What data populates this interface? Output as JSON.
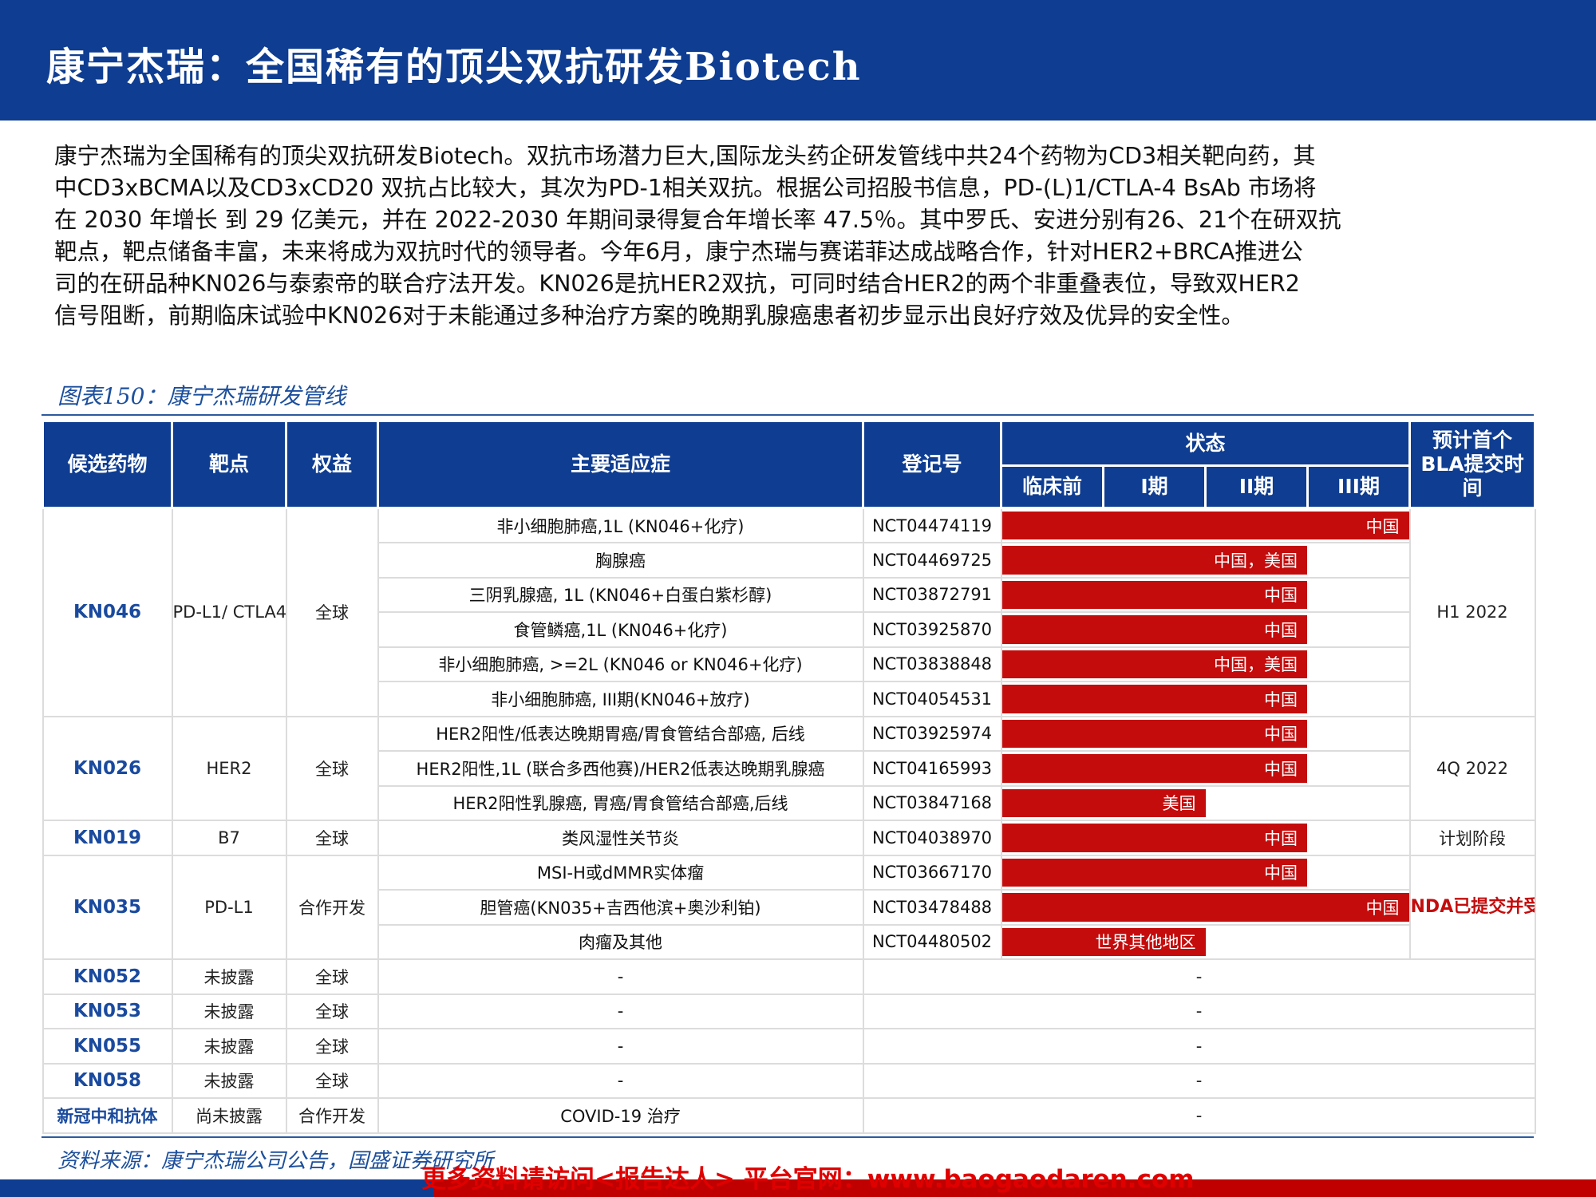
{
  "header": {
    "title": "康宁杰瑞：全国稀有的顶尖双抗研发Biotech"
  },
  "intro": {
    "lines": [
      "康宁杰瑞为全国稀有的顶尖双抗研发Biotech。双抗市场潜力巨大,国际龙头药企研发管线中共24个药物为CD3相关靶向药，其",
      "中CD3xBCMA以及CD3xCD20 双抗占比较大，其次为PD-1相关双抗。根据公司招股书信息，PD-(L)1/CTLA-4 BsAb 市场将",
      "在 2030 年增长 到 29 亿美元，并在 2022-2030 年期间录得复合年增长率 47.5％。其中罗氏、安进分别有26、21个在研双抗",
      "靶点，靶点储备丰富，未来将成为双抗时代的领导者。今年6月，康宁杰瑞与赛诺菲达成战略合作，针对HER2+BRCA推进公",
      "司的在研品种KN026与泰索帝的联合疗法开发。KN026是抗HER2双抗，可同时结合HER2的两个非重叠表位，导致双HER2",
      "信号阻断，前期临床试验中KN026对于未能通过多种治疗方案的晚期乳腺癌患者初步显示出良好疗效及优异的安全性。"
    ]
  },
  "figure": {
    "caption": "图表150：康宁杰瑞研发管线"
  },
  "table": {
    "headers": {
      "candidate": "候选药物",
      "target": "靶点",
      "rights": "权益",
      "indication": "主要适应症",
      "registration": "登记号",
      "status": "状态",
      "preclinical": "临床前",
      "phase1": "I期",
      "phase2": "II期",
      "phase3": "III期",
      "bla": "预计首个BLA提交时间"
    },
    "rows": [
      {
        "candidate": "KN046",
        "target": "PD-L1/ CTLA4",
        "rights": "全球",
        "bla": "H1 2022",
        "indications": [
          {
            "indication": "非小细胞肺癌,1L (KN046+化疗)",
            "registration": "NCT04474119",
            "region": "中国",
            "phase": 4
          },
          {
            "indication": "胸腺癌",
            "registration": "NCT04469725",
            "region": "中国，美国",
            "phase": 3
          },
          {
            "indication": "三阴乳腺癌, 1L (KN046+白蛋白紫杉醇)",
            "registration": "NCT03872791",
            "region": "中国",
            "phase": 3
          },
          {
            "indication": "食管鳞癌,1L (KN046+化疗)",
            "registration": "NCT03925870",
            "region": "中国",
            "phase": 3
          },
          {
            "indication": "非小细胞肺癌, >=2L (KN046 or KN046+化疗)",
            "registration": "NCT03838848",
            "region": "中国，美国",
            "phase": 3
          },
          {
            "indication": "非小细胞肺癌, III期(KN046+放疗)",
            "registration": "NCT04054531",
            "region": "中国",
            "phase": 3
          }
        ]
      },
      {
        "candidate": "KN026",
        "target": "HER2",
        "rights": "全球",
        "bla": "4Q 2022",
        "indications": [
          {
            "indication": "HER2阳性/低表达晚期胃癌/胃食管结合部癌, 后线",
            "registration": "NCT03925974",
            "region": "中国",
            "phase": 3
          },
          {
            "indication": "HER2阳性,1L (联合多西他赛)/HER2低表达晚期乳腺癌",
            "registration": "NCT04165993",
            "region": "中国",
            "phase": 3
          },
          {
            "indication": "HER2阳性乳腺癌, 胃癌/胃食管结合部癌,后线",
            "registration": "NCT03847168",
            "region": "美国",
            "phase": 2
          }
        ]
      },
      {
        "candidate": "KN019",
        "target": "B7",
        "rights": "全球",
        "bla": "计划阶段",
        "indications": [
          {
            "indication": "类风湿性关节炎",
            "registration": "NCT04038970",
            "region": "中国",
            "phase": 3
          }
        ]
      },
      {
        "candidate": "KN035",
        "target": "PD-L1",
        "rights": "合作开发",
        "bla": "NDA已提交并受理",
        "indications": [
          {
            "indication": "MSI-H或dMMR实体瘤",
            "registration": "NCT03667170",
            "region": "中国",
            "phase": 3
          },
          {
            "indication": "胆管癌(KN035+吉西他滨+奥沙利铂)",
            "registration": "NCT03478488",
            "region": "中国",
            "phase": 4
          },
          {
            "indication": "肉瘤及其他",
            "registration": "NCT04480502",
            "region": "世界其他地区",
            "phase": 2
          }
        ]
      },
      {
        "candidate": "KN052",
        "target": "未披露",
        "rights": "全球",
        "indication": "-",
        "rest": "-"
      },
      {
        "candidate": "KN053",
        "target": "未披露",
        "rights": "全球",
        "indication": "-",
        "rest": "-"
      },
      {
        "candidate": "KN055",
        "target": "未披露",
        "rights": "全球",
        "indication": "-",
        "rest": "-"
      },
      {
        "candidate": "KN058",
        "target": "未披露",
        "rights": "全球",
        "indication": "-",
        "rest": "-"
      },
      {
        "candidate": "新冠中和抗体",
        "target": "尚未披露",
        "rights": "合作开发",
        "indication": "COVID-19 治疗",
        "rest": "-"
      }
    ]
  },
  "source": "资料来源：康宁杰瑞公司公告，国盛证券研究所",
  "watermark": "更多资料请访问<报告达人> 平台官网：www.baogaodaren.com",
  "colors": {
    "brand_blue": "#0e3d91",
    "status_red": "#c40c0c",
    "caption_blue": "#1c4f9c"
  }
}
